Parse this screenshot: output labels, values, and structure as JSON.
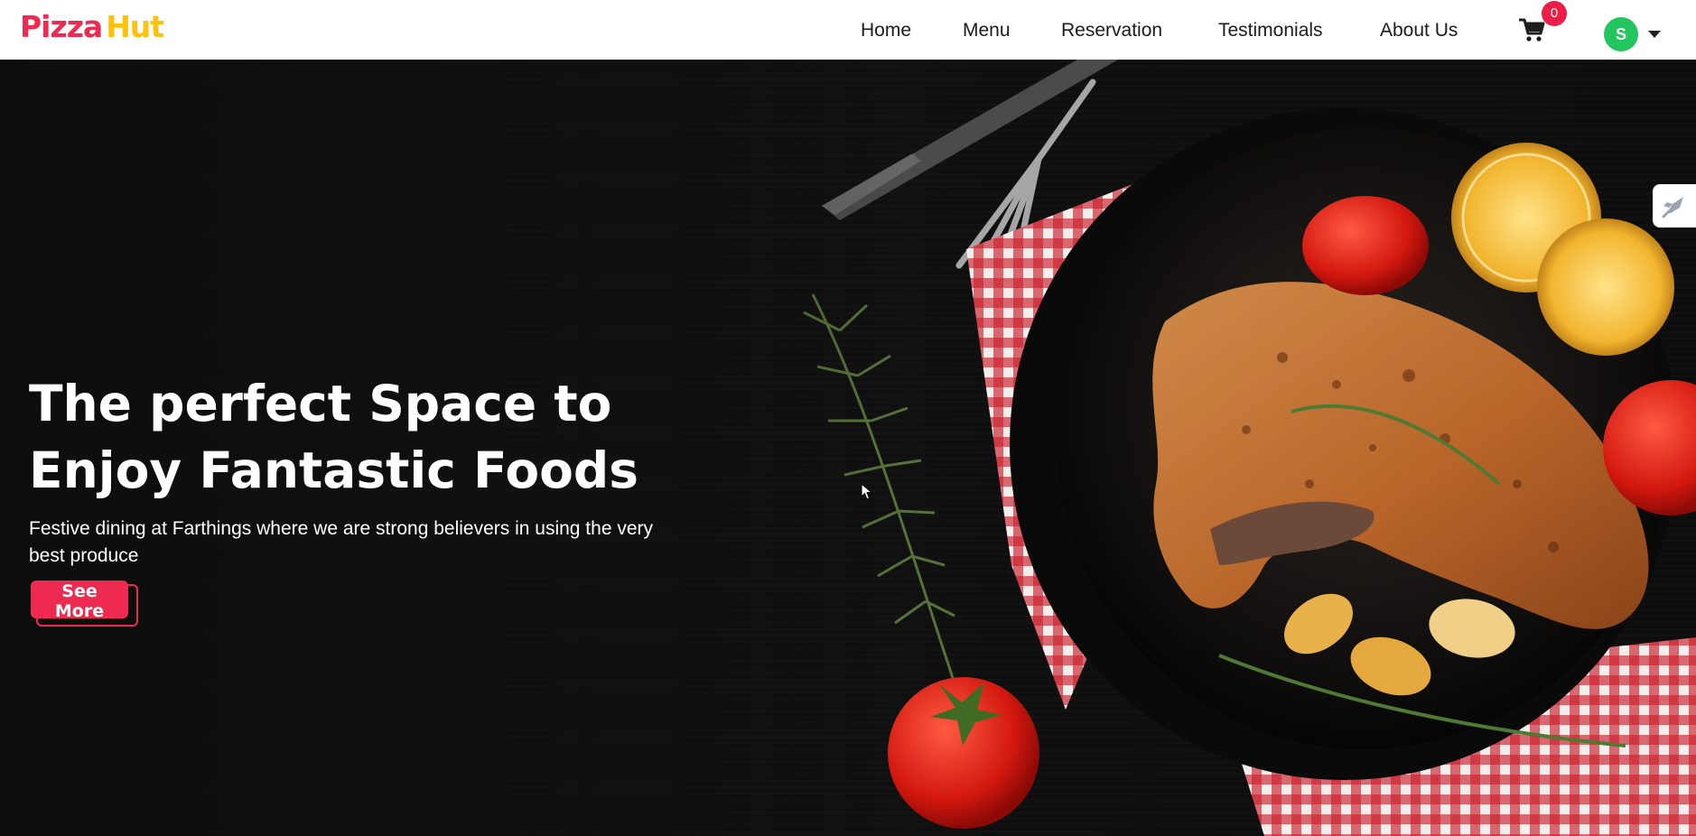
{
  "brand": {
    "part1": "Pizza",
    "part2": "Hut"
  },
  "nav": {
    "links": [
      "Home",
      "Menu",
      "Reservation",
      "Testimonials",
      "About Us"
    ],
    "cart_icon": "cart-icon",
    "cart_count": "0",
    "user_initial": "S",
    "user_menu_icon": "caret-down-icon"
  },
  "hero": {
    "title_line1": "The perfect Space to",
    "title_line2": "Enjoy Fantastic Foods",
    "subtitle": "Festive dining at Farthings where we are strong believers in using the very best produce",
    "cta": "See More"
  },
  "side_tab": {
    "icon": "rocket-icon"
  },
  "colors": {
    "brand_red": "#ee2a50",
    "brand_yellow": "#ffc10c",
    "badge_red": "#ee1d48",
    "avatar_green": "#22c55e",
    "hero_bg": "#111111"
  }
}
